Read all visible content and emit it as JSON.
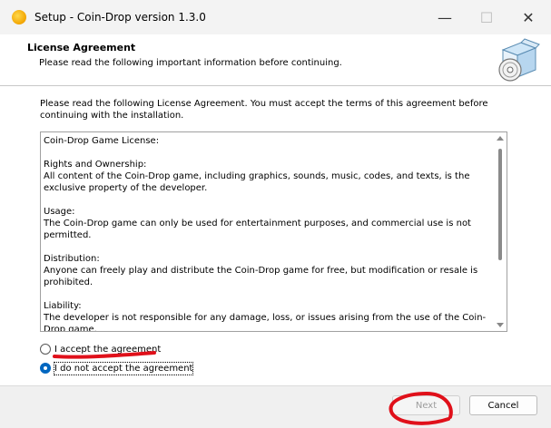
{
  "window": {
    "title": "Setup - Coin-Drop version 1.3.0",
    "minimize_glyph": "—",
    "maximize_glyph": "☐",
    "close_glyph": "✕"
  },
  "header": {
    "title": "License Agreement",
    "subtitle": "Please read the following important information before continuing.",
    "icon": "setup-box-cd-icon"
  },
  "intro": "Please read the following License Agreement. You must accept the terms of this agreement before continuing with the installation.",
  "license": {
    "paragraphs": [
      "Coin-Drop Game License:",
      "Rights and Ownership:\nAll content of the Coin-Drop game, including graphics, sounds, music, codes, and texts, is the exclusive property of the developer.",
      "Usage:\nThe Coin-Drop game can only be used for entertainment purposes, and commercial use is not permitted.",
      "Distribution:\nAnyone can freely play and distribute the Coin-Drop game for free, but modification or resale is prohibited.",
      "Liability:\nThe developer is not responsible for any damage, loss, or issues arising from the use of the Coin-Drop game."
    ]
  },
  "options": {
    "accept_label": "I accept the agreement",
    "decline_label": "I do not accept the agreement",
    "selected": "decline"
  },
  "buttons": {
    "next_label": "Next",
    "cancel_label": "Cancel",
    "next_enabled": false
  },
  "annotation_color": "#e0101a",
  "accent_color": "#0067c0"
}
